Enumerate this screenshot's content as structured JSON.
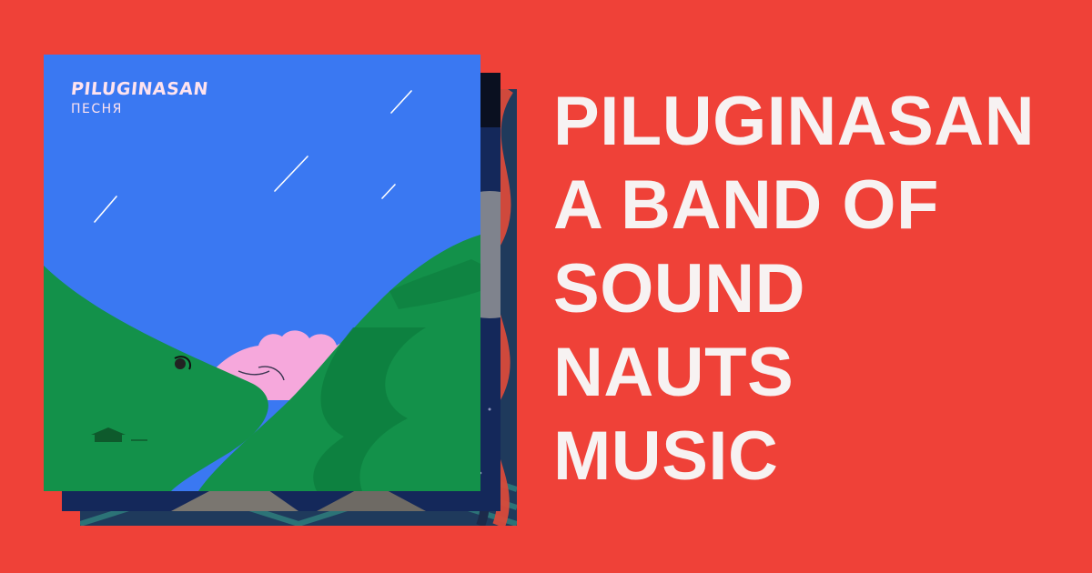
{
  "colors": {
    "background": "#ef4138",
    "headline": "#f7f2f2",
    "cover_sky": "#3a78f2",
    "cover_hill": "#13914a",
    "cover_cloud": "#f6a8dc"
  },
  "front_cover": {
    "artist": "PILUGINASAN",
    "track": "ПЕСНЯ"
  },
  "headline": {
    "lines": [
      "PILUGINASAN",
      "A BAND OF",
      "SOUND",
      "NAUTS",
      "MUSIC"
    ]
  }
}
